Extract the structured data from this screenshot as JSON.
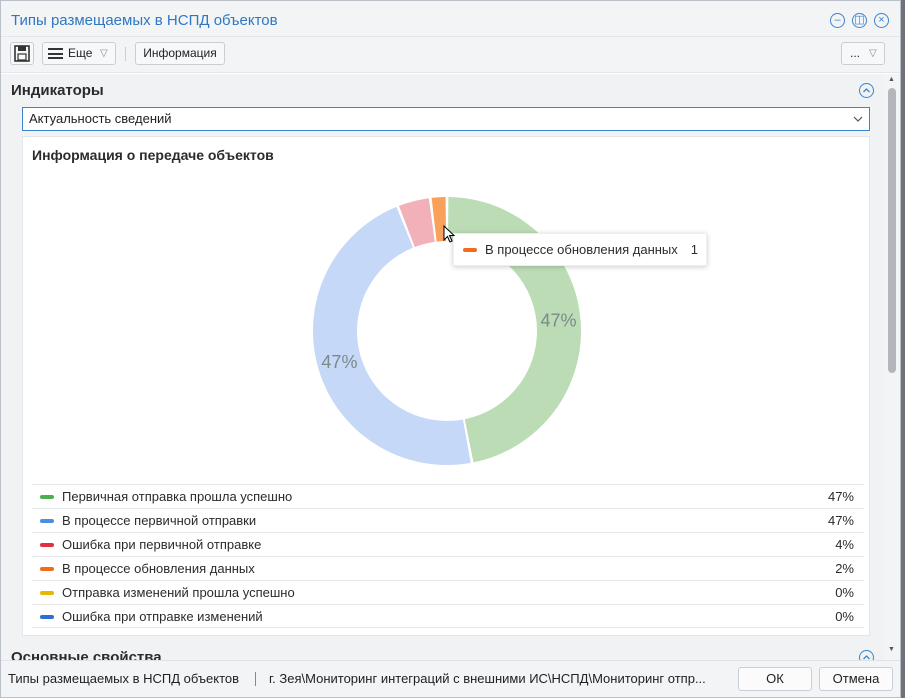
{
  "window": {
    "title": "Типы размещаемых в НСПД объектов"
  },
  "toolbar": {
    "more_label": "Еще",
    "info_label": "Информация",
    "overflow_label": "..."
  },
  "indicators": {
    "title": "Индикаторы",
    "select_value": "Актуальность сведений",
    "panel_title": "Информация о передаче объектов"
  },
  "chart_data": {
    "type": "pie",
    "title": "Информация о передаче объектов",
    "categories": [
      "Первичная отправка прошла успешно",
      "В процессе первичной отправки",
      "Ошибка при первичной отправке",
      "В процессе обновления данных",
      "Отправка изменений прошла успешно",
      "Ошибка при отправке изменений"
    ],
    "values": [
      47,
      47,
      4,
      2,
      0,
      0
    ],
    "value_labels": [
      "47%",
      "47%",
      "4%",
      "2%",
      "0%",
      "0%"
    ],
    "slice_labels": [
      "47%",
      "47%"
    ],
    "colors": [
      "#4caf50",
      "#4a90e2",
      "#e0303e",
      "#f26b1d",
      "#e6b800",
      "#2c6fd1"
    ],
    "slice_colors": [
      "#bcdcb6",
      "#c5d8f7",
      "#f2b0b8",
      "#f9a15a"
    ],
    "legend_position": "bottom"
  },
  "tooltip": {
    "label": "В процессе обновления данных",
    "value": "1"
  },
  "main_properties": {
    "title": "Основные свойства"
  },
  "status": {
    "object_name": "Типы размещаемых в НСПД объектов",
    "path": "г. Зея\\Мониторинг интеграций с внешними ИС\\НСПД\\Мониторинг отпр...",
    "ok_label": "ОК",
    "cancel_label": "Отмена"
  }
}
